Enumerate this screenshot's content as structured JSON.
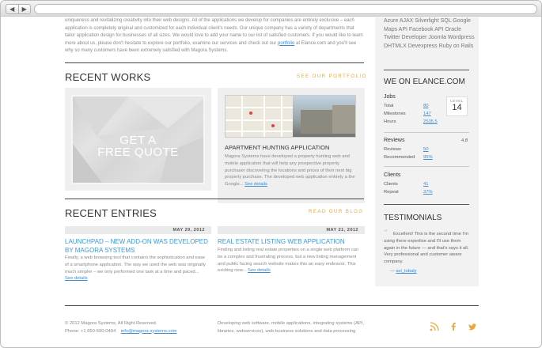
{
  "intro": {
    "line1": "uniqueness and revitalizing creativity into their web designs. All of the applications we develop for companies are entirely exclusive – each application is completely original and customized for each individual client's needs. Our unique company has a variety of departments that tailor application design for businesses of all sizes. We would love to add your name to our list of satisfied customers. If you would like to learn more about us, please don't hesitate to explore our portfolio, examine our services and check out our",
    "link": "portfolio",
    "line2": "at Elance.com and you'll see why so many customers have been extremely satisfied with Magora Systems."
  },
  "recent_works": {
    "title": "RECENT WORKS",
    "link": "SEE OUR PORTFOLIO",
    "quote_line1": "GET A",
    "quote_line2": "FREE QUOTE",
    "work_title": "APARTMENT HUNTING APPLICATION",
    "work_desc": "Magora Systems have developed a property hunting web and mobile application that will help any prospective property purchaser discovering the locations and prices of their next big property purchase. The developed web application entirely a the Google...",
    "work_more": "See details"
  },
  "recent_entries": {
    "title": "RECENT ENTRIES",
    "link": "READ OUR BLOG",
    "entries": [
      {
        "date": "MAY 29, 2012",
        "title": "LAUNCHPAD – NEW ADD-ON WAS DEVELOPED BY MAGORA SYSTEMS",
        "desc": "Finally, a web browsing tool that contains the sophistication and ease of a smartphone application. The way we used the web was originally much simpler – we only performed one task at a time and paced...",
        "more": "See details"
      },
      {
        "date": "MAY 21, 2012",
        "title": "REAL ESTATE LISTING WEB APPLICATION",
        "desc": "Finding and listing real estate properties on a single web platform can be a complex and frustrating process, but a new listing management and public facing search website makes this an easy endeavor. This exciting new...",
        "more": "See details"
      }
    ]
  },
  "sidebar": {
    "tags": "Azure AJAX Silverlight SQL Google Maps API Facebook API Oracle Twitter Developer Joomla Wordpress DHTMLX Devexpress Ruby on Rails",
    "elance_title": "WE ON ELANCE.COM",
    "jobs_title": "Jobs",
    "jobs": [
      {
        "label": "Total",
        "value": "80"
      },
      {
        "label": "Milestones",
        "value": "147"
      },
      {
        "label": "Hours",
        "value": "2535.5"
      }
    ],
    "level_label": "LEVEL",
    "level_value": "14",
    "reviews_title": "Reviews",
    "rating": "4.8",
    "reviews": [
      {
        "label": "Reviews",
        "value": "50"
      },
      {
        "label": "Recommended",
        "value": "95%"
      }
    ],
    "clients_title": "Clients",
    "clients": [
      {
        "label": "Clients",
        "value": "41"
      },
      {
        "label": "Repeat",
        "value": "37%"
      }
    ],
    "testimonials_title": "TESTIMONIALS",
    "testimonial": "Excellent! This is the second time I'm using there expertise and I'll use them again in the future — and that's says it all. Very professional and customer aware company.",
    "testimonial_author": "avi_tobaly"
  },
  "footer": {
    "copyright": "© 2012 Magora Systems, All Right Reserved.",
    "phone": "Phone:  +1 650-590-0404",
    "email": "info@magora-systems.com",
    "tagline": "Developing web software, mobile applications, integrating systems (API, libraries, webservices), web-business solutions and data processing"
  },
  "colors": {
    "accent": "#e6a93a",
    "link": "#3a8dd0"
  }
}
